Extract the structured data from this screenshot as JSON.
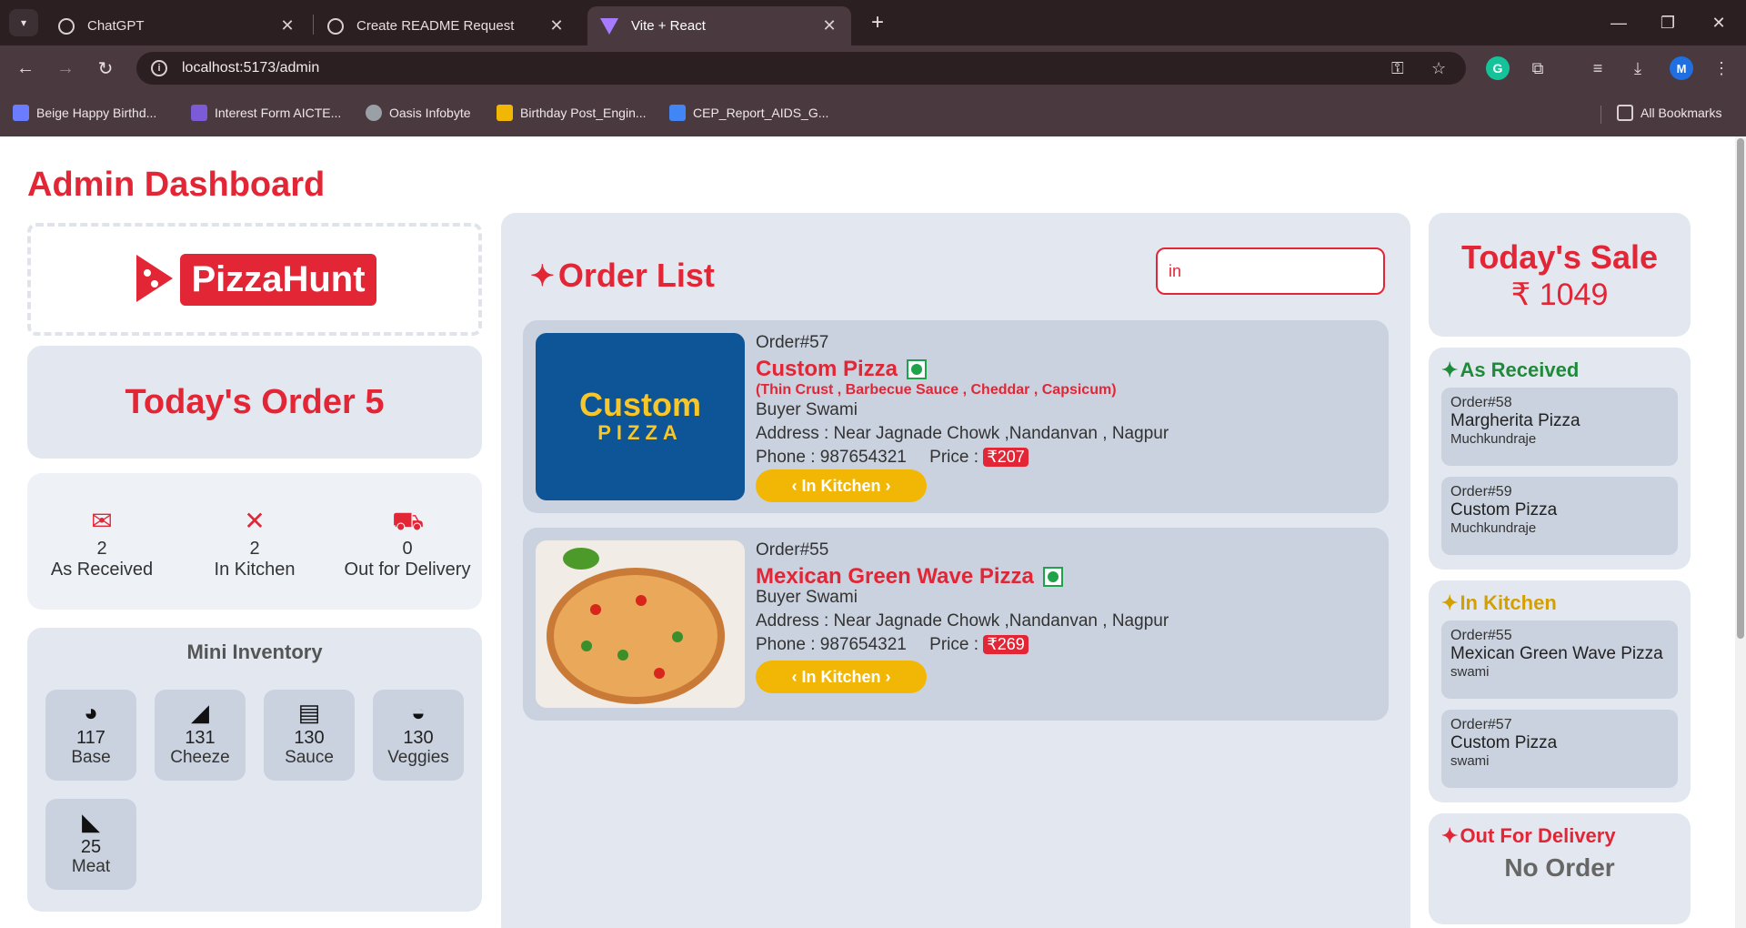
{
  "browser": {
    "tabs": [
      {
        "title": "ChatGPT"
      },
      {
        "title": "Create README Request"
      },
      {
        "title": "Vite + React"
      }
    ],
    "url": "localhost:5173/admin",
    "bookmarks": [
      {
        "label": "Beige Happy Birthd...",
        "color": "#6b7cff"
      },
      {
        "label": "Interest Form AICTE...",
        "color": "#7b5cd6"
      },
      {
        "label": "Oasis Infobyte",
        "color": "#9aa0a6"
      },
      {
        "label": "Birthday Post_Engin...",
        "color": "#f2b705"
      },
      {
        "label": "CEP_Report_AIDS_G...",
        "color": "#4285f4"
      }
    ],
    "all_bookmarks": "All Bookmarks",
    "avatar_letter": "M"
  },
  "page": {
    "title": "Admin Dashboard",
    "logo_text": "PizzaHunt",
    "todays_order": "Today's Order 5",
    "status": [
      {
        "count": "2",
        "label": "As Received",
        "icon": "mail-check-icon"
      },
      {
        "count": "2",
        "label": "In Kitchen",
        "icon": "utensils-icon"
      },
      {
        "count": "0",
        "label": "Out for Delivery",
        "icon": "delivery-truck-icon"
      }
    ],
    "inventory": {
      "title": "Mini Inventory",
      "items": [
        {
          "count": "117",
          "label": "Base",
          "icon": "pie-icon"
        },
        {
          "count": "131",
          "label": "Cheeze",
          "icon": "cheese-icon"
        },
        {
          "count": "130",
          "label": "Sauce",
          "icon": "sauce-jar-icon"
        },
        {
          "count": "130",
          "label": "Veggies",
          "icon": "bowl-icon"
        },
        {
          "count": "25",
          "label": "Meat",
          "icon": "meat-icon"
        }
      ]
    },
    "order_list": {
      "title": "Order List",
      "search_value": "in",
      "orders": [
        {
          "id": "Order#57",
          "name": "Custom Pizza",
          "desc": "(Thin Crust , Barbecue Sauce , Cheddar , Capsicum)",
          "buyer": "Buyer Swami",
          "address": "Address : Near Jagnade Chowk ,Nandanvan , Nagpur",
          "phone": "Phone : 987654321",
          "price_label": "Price :",
          "price": "₹207",
          "status_btn": "‹ In Kitchen ›",
          "thumb_line1": "Custom",
          "thumb_line2": "PIZZA"
        },
        {
          "id": "Order#55",
          "name": "Mexican Green Wave Pizza",
          "buyer": "Buyer Swami",
          "address": "Address : Near Jagnade Chowk ,Nandanvan , Nagpur",
          "phone": "Phone : 987654321",
          "price_label": "Price :",
          "price": "₹269",
          "status_btn": "‹ In Kitchen ›"
        }
      ]
    },
    "sale": {
      "title": "Today's Sale",
      "value": "₹ 1049"
    },
    "as_received": {
      "title": "As Received",
      "color": "#1e8a3a",
      "items": [
        {
          "id": "Order#58",
          "name": "Margherita Pizza",
          "buyer": "Muchkundraje"
        },
        {
          "id": "Order#59",
          "name": "Custom Pizza",
          "buyer": "Muchkundraje"
        }
      ]
    },
    "in_kitchen": {
      "title": "In Kitchen",
      "color": "#d4a000",
      "items": [
        {
          "id": "Order#55",
          "name": "Mexican Green Wave Pizza",
          "buyer": "swami"
        },
        {
          "id": "Order#57",
          "name": "Custom Pizza",
          "buyer": "swami"
        }
      ]
    },
    "out_for_delivery": {
      "title": "Out For Delivery",
      "color": "#e32636",
      "empty_text": "No Order"
    }
  }
}
